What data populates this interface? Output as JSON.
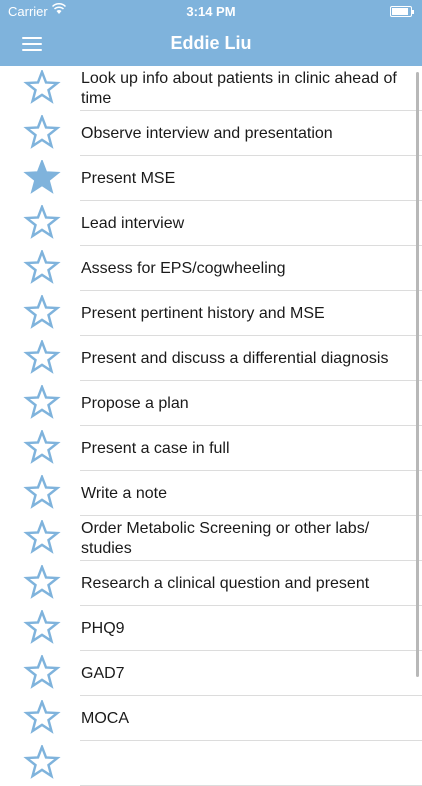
{
  "status_bar": {
    "carrier": "Carrier",
    "time": "3:14 PM"
  },
  "header": {
    "title": "Eddie Liu",
    "menu_icon": "hamburger-menu-icon"
  },
  "colors": {
    "header_bg": "#7fb3dc",
    "star": "#7fb3dc",
    "separator": "#dcdcdc"
  },
  "items": [
    {
      "label": "Look up info about patients in clinic ahead of time",
      "starred": false
    },
    {
      "label": "Observe interview and presentation",
      "starred": false
    },
    {
      "label": "Present MSE",
      "starred": true
    },
    {
      "label": "Lead interview",
      "starred": false
    },
    {
      "label": "Assess for EPS/cogwheeling",
      "starred": false
    },
    {
      "label": "Present pertinent history and MSE",
      "starred": false
    },
    {
      "label": "Present and discuss a differential diagnosis",
      "starred": false
    },
    {
      "label": "Propose a plan",
      "starred": false
    },
    {
      "label": "Present a case in full",
      "starred": false
    },
    {
      "label": "Write a note",
      "starred": false
    },
    {
      "label": "Order Metabolic Screening or other labs/ studies",
      "starred": false
    },
    {
      "label": "Research a clinical question and present",
      "starred": false
    },
    {
      "label": "PHQ9",
      "starred": false
    },
    {
      "label": "GAD7",
      "starred": false
    },
    {
      "label": "MOCA",
      "starred": false
    },
    {
      "label": "",
      "starred": false
    }
  ]
}
